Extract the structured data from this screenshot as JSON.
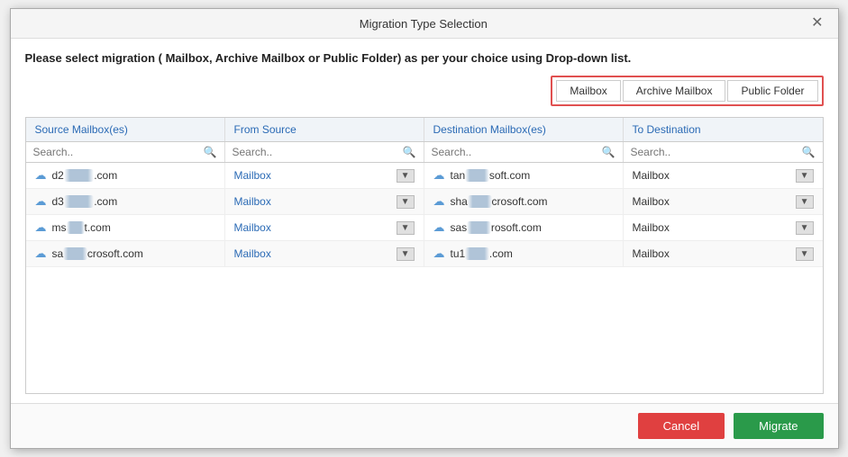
{
  "dialog": {
    "title": "Migration Type Selection",
    "close_label": "✕",
    "instruction": "Please select migration ( Mailbox, Archive Mailbox or Public Folder) as per your choice using Drop-down list."
  },
  "type_buttons": {
    "mailbox": "Mailbox",
    "archive": "Archive Mailbox",
    "public": "Public Folder"
  },
  "table": {
    "headers": [
      "Source Mailbox(es)",
      "From Source",
      "Destination Mailbox(es)",
      "To Destination"
    ],
    "search_placeholders": [
      "Search..",
      "Search..",
      "Search..",
      "Search.."
    ],
    "rows": [
      {
        "source": "d2██████████.com",
        "source_prefix": "d2",
        "source_blur": "██████████",
        "source_suffix": ".com",
        "from": "Mailbox",
        "dest": "tan██████████soft.com",
        "dest_prefix": "tan",
        "dest_blur": "████████",
        "dest_suffix": "soft.com",
        "to": "Mailbox"
      },
      {
        "source": "d3██████████.com",
        "source_prefix": "d3",
        "source_blur": "██████████",
        "source_suffix": ".com",
        "from": "Mailbox",
        "dest": "sha██████████crosoft.com",
        "dest_prefix": "sha",
        "dest_blur": "████████",
        "dest_suffix": "crosoft.com",
        "to": "Mailbox"
      },
      {
        "source": "ms██████t.com",
        "source_prefix": "ms",
        "source_blur": "██████",
        "source_suffix": "t.com",
        "from": "Mailbox",
        "dest": "sas██████████rosoft.com",
        "dest_prefix": "sas",
        "dest_blur": "████████",
        "dest_suffix": "rosoft.com",
        "to": "Mailbox"
      },
      {
        "source": "sa████████crosoft.com",
        "source_prefix": "sa",
        "source_blur": "████████",
        "source_suffix": "crosoft.com",
        "from": "Mailbox",
        "dest": "tu1██████████.com",
        "dest_prefix": "tu1",
        "dest_blur": "████████",
        "dest_suffix": ".com",
        "to": "Mailbox"
      }
    ]
  },
  "footer": {
    "cancel": "Cancel",
    "migrate": "Migrate"
  }
}
